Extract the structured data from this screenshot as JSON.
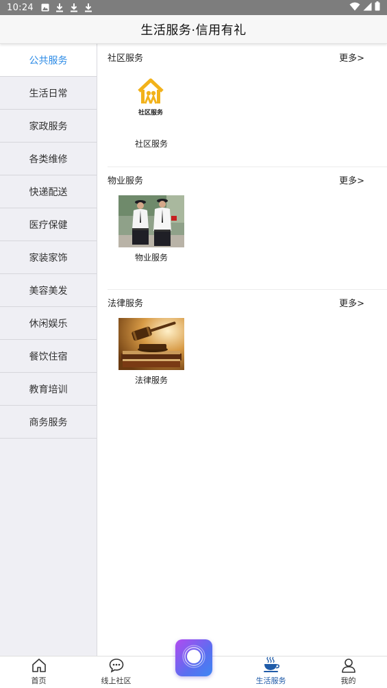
{
  "status_bar": {
    "time": "10:24",
    "left_icons": [
      "image-notification-icon",
      "download-icon",
      "download-icon",
      "download-icon"
    ],
    "right_icons": [
      "wifi-icon",
      "signal-icon",
      "battery-icon"
    ]
  },
  "header": {
    "title": "生活服务·信用有礼"
  },
  "sidebar": {
    "active_color": "#2a8ae6",
    "items": [
      {
        "label": "公共服务",
        "active": true
      },
      {
        "label": "生活日常"
      },
      {
        "label": "家政服务"
      },
      {
        "label": "各类维修"
      },
      {
        "label": "快递配送"
      },
      {
        "label": "医疗保健"
      },
      {
        "label": "家装家饰"
      },
      {
        "label": "美容美发"
      },
      {
        "label": "休闲娱乐"
      },
      {
        "label": "餐饮住宿"
      },
      {
        "label": "教育培训"
      },
      {
        "label": "商务服务"
      }
    ]
  },
  "sections": [
    {
      "title": "社区服务",
      "more": "更多>",
      "items": [
        {
          "label": "社区服务",
          "image_text": "社区服务",
          "icon": "community-logo-icon",
          "logo_color": "#f2b21b"
        }
      ]
    },
    {
      "title": "物业服务",
      "more": "更多>",
      "items": [
        {
          "label": "物业服务",
          "icon": "security-guards-photo"
        }
      ]
    },
    {
      "title": "法律服务",
      "more": "更多>",
      "items": [
        {
          "label": "法律服务",
          "icon": "gavel-photo"
        }
      ]
    }
  ],
  "bottom_nav": {
    "active_color": "#1f5ba8",
    "items": [
      {
        "label": "首页",
        "icon": "home-icon"
      },
      {
        "label": "线上社区",
        "icon": "chat-bubble-icon"
      },
      {
        "label": "生活服务",
        "icon": "coffee-cup-icon",
        "active": true
      },
      {
        "label": "我的",
        "icon": "user-icon"
      }
    ],
    "center_button_icon": "center-circle-icon"
  }
}
